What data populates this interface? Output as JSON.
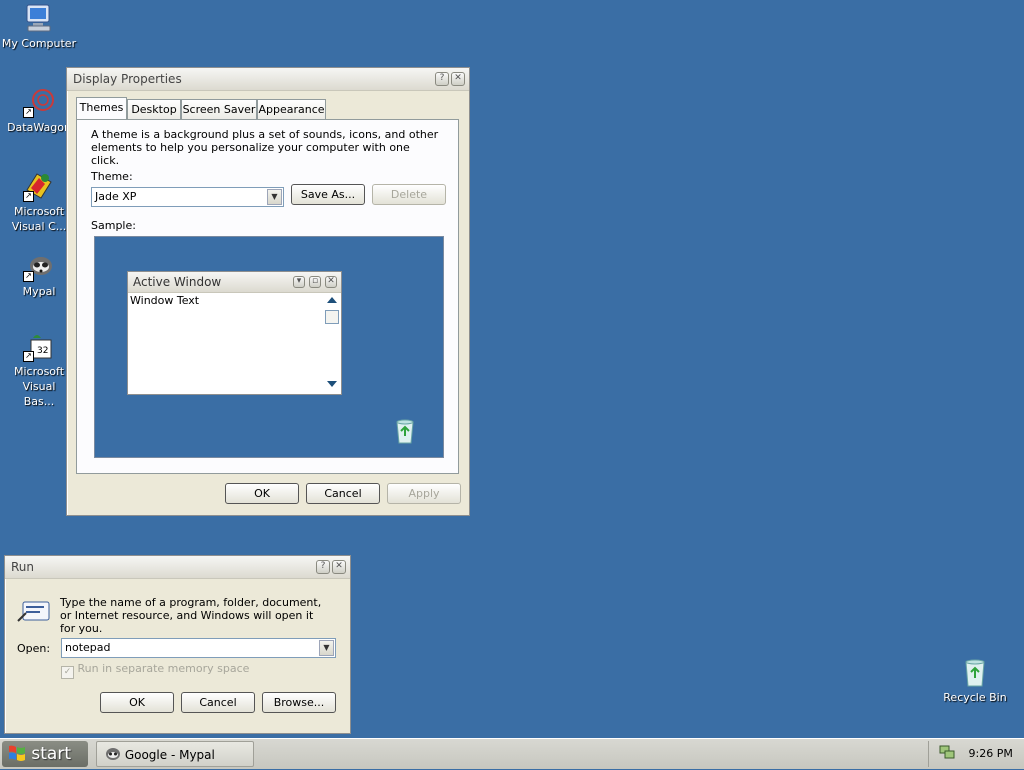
{
  "desktop": {
    "icons": [
      {
        "label": "My Computer"
      },
      {
        "label": "DataWagon"
      },
      {
        "label": "Microsoft Visual C..."
      },
      {
        "label": "Mypal"
      },
      {
        "label": "Microsoft Visual Bas..."
      },
      {
        "label": "Recycle Bin"
      }
    ]
  },
  "display_properties": {
    "title": "Display Properties",
    "tabs": [
      "Themes",
      "Desktop",
      "Screen Saver",
      "Appearance"
    ],
    "active_tab": "Themes",
    "description": "A theme is a background plus a set of sounds, icons, and other elements to help you personalize your computer with one click.",
    "theme_label": "Theme:",
    "theme_value": "Jade XP",
    "save_as_label": "Save As...",
    "delete_label": "Delete",
    "sample_label": "Sample:",
    "sample": {
      "window_title": "Active Window",
      "window_text": "Window Text"
    },
    "ok_label": "OK",
    "cancel_label": "Cancel",
    "apply_label": "Apply"
  },
  "run_dialog": {
    "title": "Run",
    "description": "Type the name of a program, folder, document, or Internet resource, and Windows will open it for you.",
    "open_label": "Open:",
    "open_value": "notepad",
    "checkbox_label": "Run in separate memory space",
    "checkbox_checked": true,
    "ok_label": "OK",
    "cancel_label": "Cancel",
    "browse_label": "Browse..."
  },
  "taskbar": {
    "start_label": "start",
    "task_label": "Google - Mypal",
    "clock": "9:26 PM"
  },
  "colors": {
    "desktop": "#3a6ea5",
    "window_face": "#ece9d8"
  }
}
